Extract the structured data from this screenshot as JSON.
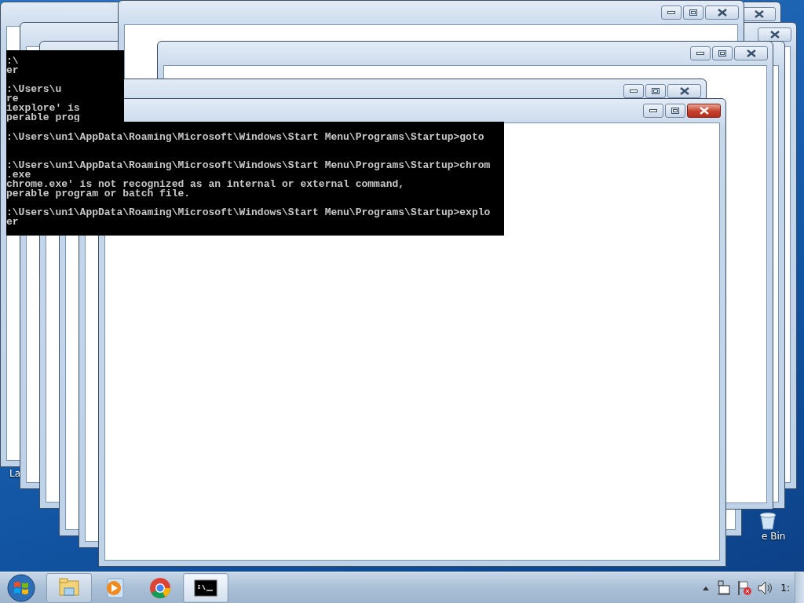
{
  "desktop": {
    "icons": [
      {
        "kind": "label",
        "label": "La"
      },
      {
        "kind": "recycle-bin",
        "label": "e Bin"
      }
    ]
  },
  "windows": [
    {
      "kind": "closable",
      "active": false
    },
    {
      "kind": "closable",
      "active": false
    },
    {
      "kind": "bare"
    },
    {
      "kind": "bare"
    },
    {
      "kind": "full",
      "active": false
    },
    {
      "kind": "full",
      "active": false
    },
    {
      "kind": "full",
      "active": false
    },
    {
      "kind": "full",
      "active": true
    }
  ],
  "back_console": {
    "lines": [
      {
        "text": ":\\",
        "kind": "prompt"
      },
      {
        "text": "er",
        "kind": "output"
      },
      {
        "text": ":\\Users\\u",
        "kind": "prompt"
      },
      {
        "text": "re",
        "kind": "output"
      },
      {
        "text": "iexplore' is",
        "kind": "output"
      },
      {
        "text": "perable prog",
        "kind": "output"
      }
    ]
  },
  "console": {
    "lines": [
      {
        "text": ":\\Users\\un1\\AppData\\Roaming\\Microsoft\\Windows\\Start Menu\\Programs\\Startup>goto",
        "kind": "prompt"
      },
      {
        "text": ":\\Users\\un1\\AppData\\Roaming\\Microsoft\\Windows\\Start Menu\\Programs\\Startup>chrom",
        "kind": "prompt2"
      },
      {
        "text": ".exe",
        "kind": "output"
      },
      {
        "text": "chrome.exe' is not recognized as an internal or external command,",
        "kind": "output"
      },
      {
        "text": "perable program or batch file.",
        "kind": "output"
      },
      {
        "text": ":\\Users\\un1\\AppData\\Roaming\\Microsoft\\Windows\\Start Menu\\Programs\\Startup>explo",
        "kind": "prompt"
      },
      {
        "text": "er",
        "kind": "output"
      }
    ]
  },
  "taskbar": {
    "items": [
      {
        "kind": "explorer",
        "running": true,
        "selected": false
      },
      {
        "kind": "media",
        "running": false,
        "selected": false
      },
      {
        "kind": "chrome",
        "running": false,
        "selected": false
      },
      {
        "kind": "cmd",
        "running": true,
        "selected": true
      }
    ],
    "tray": [
      {
        "kind": "arrow"
      },
      {
        "kind": "network"
      },
      {
        "kind": "flag"
      },
      {
        "kind": "volume"
      }
    ],
    "clock": "1:"
  }
}
